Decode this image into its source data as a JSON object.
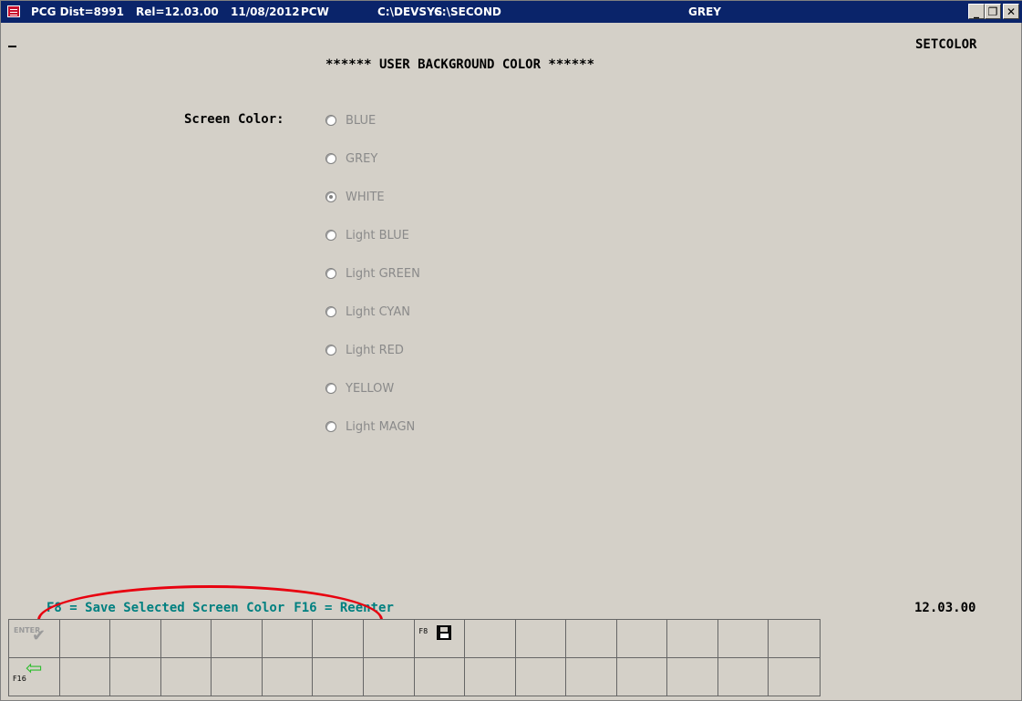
{
  "window": {
    "title_parts": {
      "dist": "PCG Dist=8991",
      "rel": "Rel=12.03.00",
      "date": "11/08/2012",
      "app": "PCW",
      "dir1": "C:\\DEVSYS",
      "dir2": "C:\\SECOND",
      "color": "GREY"
    },
    "controls": {
      "minimize": "_",
      "restore": "❐",
      "close": "✕"
    }
  },
  "screen": {
    "program_name": "SETCOLOR",
    "title": "****** USER BACKGROUND COLOR ******",
    "field_label": "Screen Color:",
    "options": [
      {
        "label": "BLUE",
        "selected": false
      },
      {
        "label": "GREY",
        "selected": false
      },
      {
        "label": "WHITE",
        "selected": true
      },
      {
        "label": "Light BLUE",
        "selected": false
      },
      {
        "label": "Light GREEN",
        "selected": false
      },
      {
        "label": "Light CYAN",
        "selected": false
      },
      {
        "label": "Light RED",
        "selected": false
      },
      {
        "label": "YELLOW",
        "selected": false
      },
      {
        "label": "Light MAGN",
        "selected": false
      }
    ]
  },
  "footer": {
    "fkey_help_f8": "F8 = Save Selected Screen Color",
    "fkey_help_f16": "F16 = Reenter",
    "version": "12.03.00"
  },
  "function_keys": {
    "enter_label": "ENTER",
    "check_glyph": "✔",
    "f8_label": "F8",
    "f16_label": "F16",
    "back_arrow_glyph": "⇦"
  },
  "colors": {
    "title_bar": "#0a246a",
    "background": "#d4d0c8",
    "help_text": "#008080",
    "highlight_ellipse": "#e8000f"
  }
}
